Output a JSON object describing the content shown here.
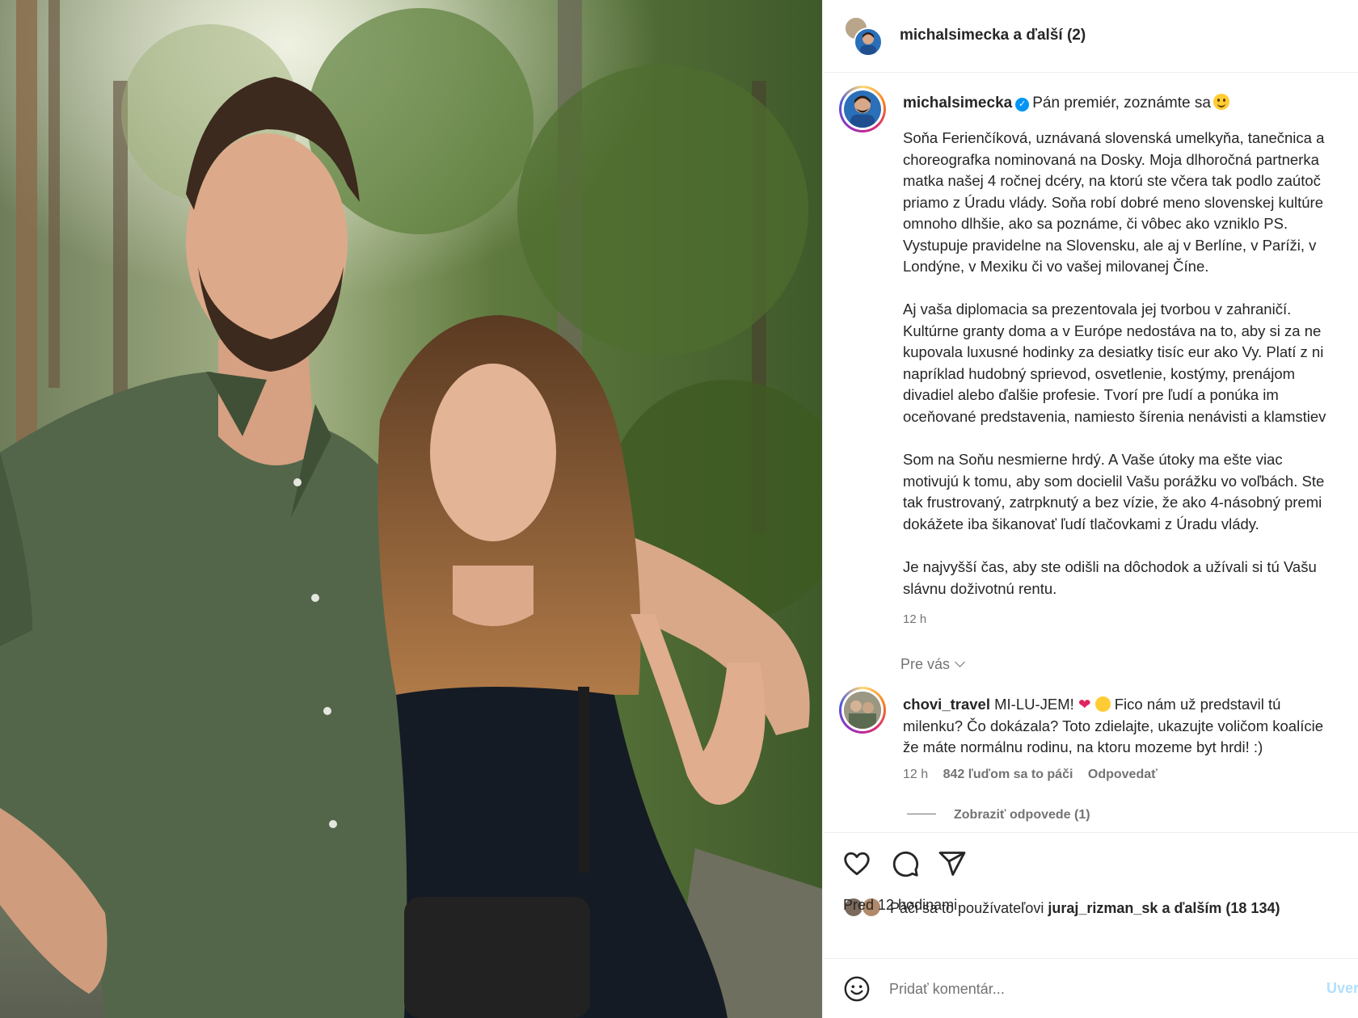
{
  "header": {
    "title": "michalsimecka a ďalší (2)"
  },
  "caption": {
    "username": "michalsimecka",
    "headline": "Pán premiér, zoznámte sa",
    "paragraphs": [
      "Soňa Ferienčíková, uznávaná slovenská umelkyňa, tanečnica a\nchoreografka nominovaná na Dosky. Moja dlhoročná partnerka\nmatka našej 4 ročnej dcéry, na ktorú ste včera tak podlo zaútoč\npriamo z Úradu vlády. Soňa robí dobré meno slovenskej kultúre\nomnoho dlhšie, ako sa poznáme, či vôbec ako vzniklo PS.\nVystupuje pravidelne na Slovensku, ale aj v Berlíne, v Paríži, v\nLondýne, v Mexiku či vo vašej milovanej Číne.",
      "Aj vaša diplomacia sa prezentovala jej tvorbou v zahraničí.\nKultúrne granty doma a v Európe nedostáva na to, aby si za ne\nkupovala luxusné hodinky za desiatky tisíc eur ako Vy. Platí z ni\nnapríklad hudobný sprievod, osvetlenie, kostýmy, prenájom\ndivadiel alebo ďalšie profesie. Tvorí pre ľudí a ponúka im\noceňované predstavenia, namiesto šírenia nenávisti a klamstiev",
      "Som na Soňu nesmierne hrdý. A Vaše útoky ma ešte viac\nmotivujú k tomu, aby som docielil Vašu porážku vo voľbách. Ste\ntak frustrovaný, zatrpknutý a bez vízie, že ako 4-násobný premi\ndokážete iba šikanovať ľudí tlačovkami z Úradu vlády.",
      "Je najvyšší čas, aby ste odišli na dôchodok a užívali si tú Vašu\nslávnu doživotnú rentu."
    ],
    "time": "12 h"
  },
  "for_you": "Pre vás",
  "comment": {
    "username": "chovi_travel",
    "text_part1": "MI-LU-JEM! ",
    "text_part2": " Fico nám už predstavil tú\nmilenku? Čo dokázala? Toto zdielajte, ukazujte voličom koalície\nže máte normálnu rodinu, na ktoru mozeme byt hrdi! :)",
    "heart": "❤",
    "time": "12 h",
    "likes": "842 ľuďom sa to páči",
    "reply": "Odpovedať",
    "view_replies": "Zobraziť odpovede (1)"
  },
  "actions": {
    "icons": [
      "heart-outline-icon",
      "comment-bubble-icon",
      "share-paper-plane-icon"
    ]
  },
  "likes": {
    "prefix": "Páči sa to používateľovi ",
    "user": "juraj_rizman_sk",
    "suffix": " a ďalším (18 134)",
    "ago": "Pred 12 hodinami"
  },
  "add_comment": {
    "placeholder": "Pridať komentár...",
    "post_label": "Uverejniť"
  },
  "colors": {
    "verified": "#0095f6",
    "muted_text": "#737373",
    "post_disabled": "#b2dffc"
  }
}
